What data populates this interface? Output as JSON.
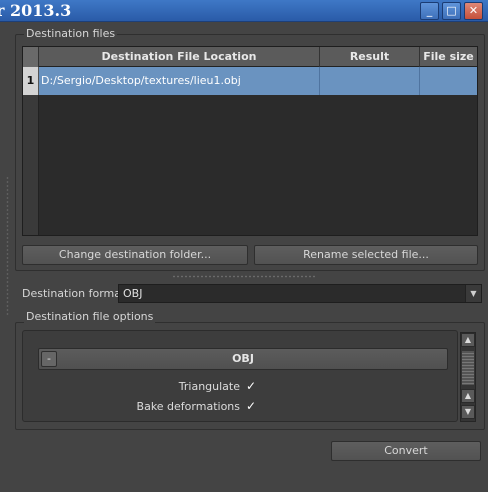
{
  "window": {
    "title": "r 2013.3",
    "minimize_glyph": "_",
    "maximize_glyph": "□",
    "close_glyph": "✕"
  },
  "destination_files": {
    "label": "Destination files",
    "columns": [
      "Destination File Location",
      "Result",
      "File size"
    ],
    "rows": [
      {
        "num": "1",
        "location": "D:/Sergio/Desktop/textures/lieu1.obj",
        "result": "",
        "file_size": ""
      }
    ],
    "change_folder_button": "Change destination folder...",
    "rename_button": "Rename selected file..."
  },
  "destination_format": {
    "label": "Destination format",
    "value": "OBJ"
  },
  "destination_file_options": {
    "label": "Destination file options",
    "section": {
      "collapse_glyph": "-",
      "title": "OBJ"
    },
    "options": [
      {
        "label": "Triangulate",
        "checked": true
      },
      {
        "label": "Bake deformations",
        "checked": true
      }
    ]
  },
  "convert_button": "Convert",
  "colors": {
    "selection": "#6a93c0",
    "titlebar": "#3f78c6",
    "background": "#444444"
  }
}
